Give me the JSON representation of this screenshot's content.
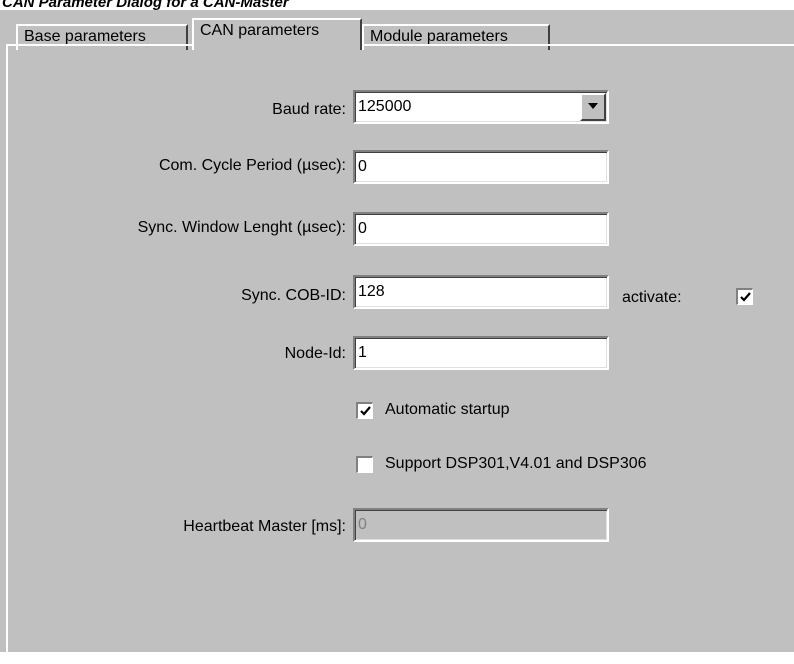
{
  "caption": "CAN Parameter Dialog for a CAN-Master",
  "tabs": [
    {
      "label": "Base parameters",
      "active": false
    },
    {
      "label": "CAN parameters",
      "active": true
    },
    {
      "label": "Module parameters",
      "active": false
    }
  ],
  "form": {
    "baud_rate": {
      "label": "Baud rate:",
      "value": "125000"
    },
    "com_cycle": {
      "label": "Com. Cycle Period (µsec):",
      "value": "0"
    },
    "sync_window": {
      "label": "Sync. Window Lenght (µsec):",
      "value": "0"
    },
    "sync_cob": {
      "label": "Sync. COB-ID:",
      "value": "128",
      "activate_label": "activate:",
      "activate_checked": true
    },
    "node_id": {
      "label": "Node-Id:",
      "value": "1"
    },
    "automatic_startup": {
      "label": "Automatic startup",
      "checked": true
    },
    "support_dsp": {
      "label": "Support DSP301,V4.01 and DSP306",
      "checked": false
    },
    "heartbeat": {
      "label": "Heartbeat Master [ms]:",
      "value": "0",
      "disabled": true
    }
  },
  "icons": {
    "dropdown": "chevron-down-icon",
    "checkmark": "checkmark-icon"
  }
}
